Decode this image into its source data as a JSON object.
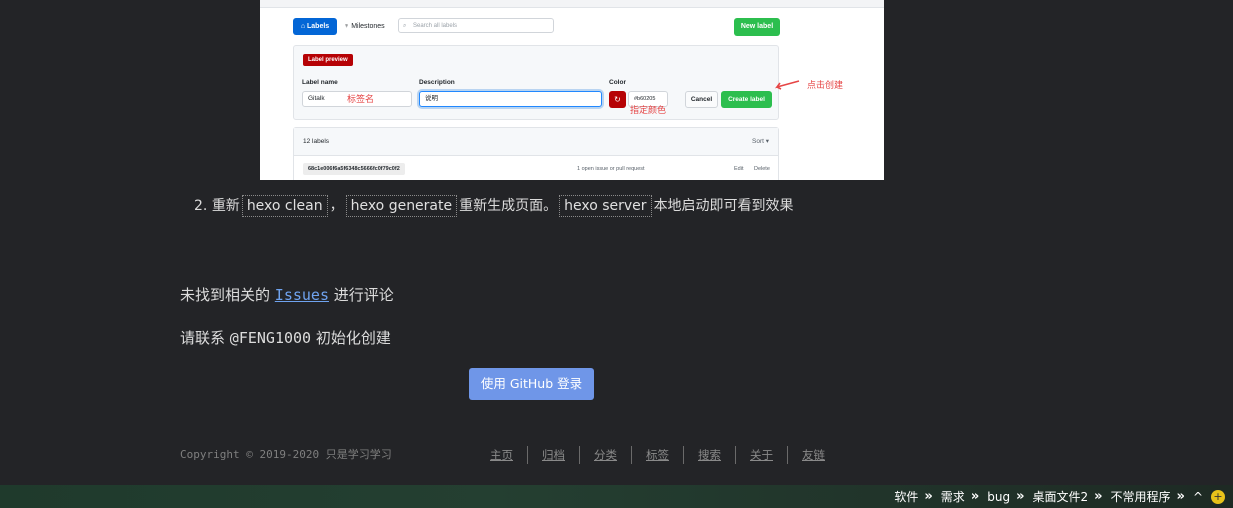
{
  "screenshot": {
    "labels_button": "Labels",
    "milestones_button": "Milestones",
    "search_placeholder": "Search all labels",
    "new_label_button": "New label",
    "label_preview": "Label preview",
    "label_name_heading": "Label name",
    "label_name_value": "Gitalk",
    "label_name_note": "标签名",
    "description_heading": "Description",
    "description_value": "说明",
    "color_heading": "Color",
    "color_value": "#b60205",
    "color_note": "指定颜色",
    "cancel_button": "Cancel",
    "create_button": "Create label",
    "create_note": "点击创建",
    "labels_count": "12 labels",
    "sort": "Sort ▾",
    "label_pill": "68c1e006f6a5f6348c5666fc0f79c0f2",
    "open_issues": "1 open issue or pull request",
    "edit": "Edit",
    "delete": "Delete"
  },
  "step": {
    "number": "2.",
    "t1": "重新",
    "code1": "hexo clean",
    "t2": "，",
    "code2": "hexo generate",
    "t3": "重新生成页面。",
    "code3": "hexo server",
    "t4": "本地启动即可看到效果"
  },
  "comments": {
    "line1_prefix": "未找到相关的",
    "issues_link": "Issues",
    "line1_suffix": "进行评论",
    "line2_prefix": "请联系",
    "user": "@FENG1000",
    "line2_suffix": "初始化创建",
    "login_button": "使用 GitHub 登录"
  },
  "footer": {
    "copyright": "Copyright © 2019-2020 只是学习学习",
    "nav": [
      "主页",
      "归档",
      "分类",
      "标签",
      "搜索",
      "关于",
      "友链"
    ]
  },
  "taskbar": {
    "items": [
      "软件",
      "需求",
      "bug",
      "桌面文件2",
      "不常用程序"
    ],
    "chevron": "»",
    "up_arrow": "^"
  },
  "colors": {
    "background": "#232427",
    "link": "#6fa3ef",
    "login_button": "#6f96e8",
    "label_red": "#b60205",
    "github_green": "#2cbe4e"
  }
}
